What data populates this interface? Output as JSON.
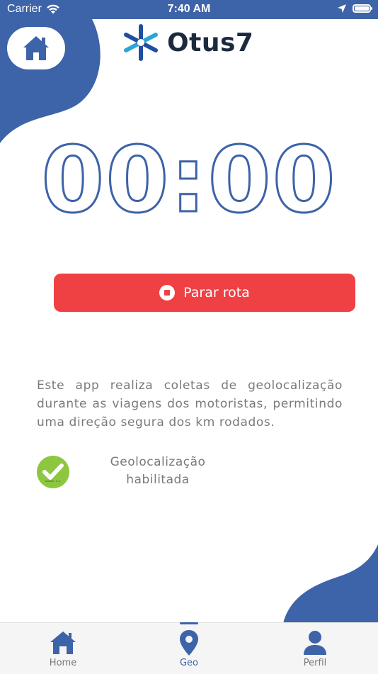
{
  "status_bar": {
    "carrier": "Carrier",
    "time": "7:40 AM"
  },
  "brand": {
    "name": "Otus7",
    "primary_color": "#3d63a8",
    "accent_color": "#ef4043",
    "success_color": "#8dc63f"
  },
  "header": {
    "home_icon": "home-icon"
  },
  "timer": {
    "value": "00:00"
  },
  "actions": {
    "stop_label": "Parar rota",
    "stop_icon": "stop-icon"
  },
  "info": {
    "description": "Este app realiza coletas de geolocalização durante as viagens dos motoristas, permitindo uma direção segura dos km rodados."
  },
  "geo_status": {
    "line1": "Geolocalização",
    "line2": "habilitada",
    "icon": "check-badge-icon"
  },
  "tab_bar": {
    "tabs": [
      {
        "label": "Home",
        "icon": "home-icon",
        "active": false
      },
      {
        "label": "Geo",
        "icon": "location-pin-icon",
        "active": true
      },
      {
        "label": "Perfil",
        "icon": "person-icon",
        "active": false
      }
    ]
  }
}
